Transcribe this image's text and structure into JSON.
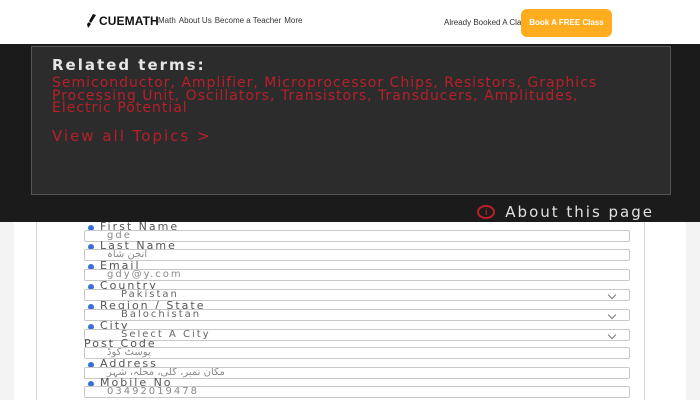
{
  "header": {
    "logo_text": "CUEMATH",
    "nav_links": [
      "Math",
      "About Us",
      "Become a Teacher",
      "More"
    ],
    "already_booked": "Already Booked A Class?",
    "cta_label": "Book A FREE Class",
    "accent_color": "#ffad1f"
  },
  "related": {
    "title": "Related terms:",
    "terms": "Semiconductor, Amplifier, Microprocessor Chips, Resistors, Graphics Processing Unit, Oscillators, Transistors, Transducers, Amplitudes, Electric Potential",
    "view_all": "View all Topics  >",
    "about": "About this page",
    "term_color": "#b81f29"
  },
  "form": {
    "first_name": {
      "label": "First Name",
      "value": "gde"
    },
    "last_name": {
      "label": "Last Name",
      "value": "انجن شاہ"
    },
    "email": {
      "label": "Email",
      "value": "gdy@y.com"
    },
    "country": {
      "label": "Country",
      "value": "Pakistan"
    },
    "region": {
      "label": "Region / State",
      "value": "Balochistan"
    },
    "city": {
      "label": "City",
      "value": "Select A City"
    },
    "post_code": {
      "label": "Post Code",
      "value": "پوسٹ کوڈ"
    },
    "address": {
      "label": "Address",
      "value": "مکان نمبر، گلی، محلہ، شہر"
    },
    "mobile": {
      "label": "Mobile No",
      "value": "03492019478"
    }
  }
}
